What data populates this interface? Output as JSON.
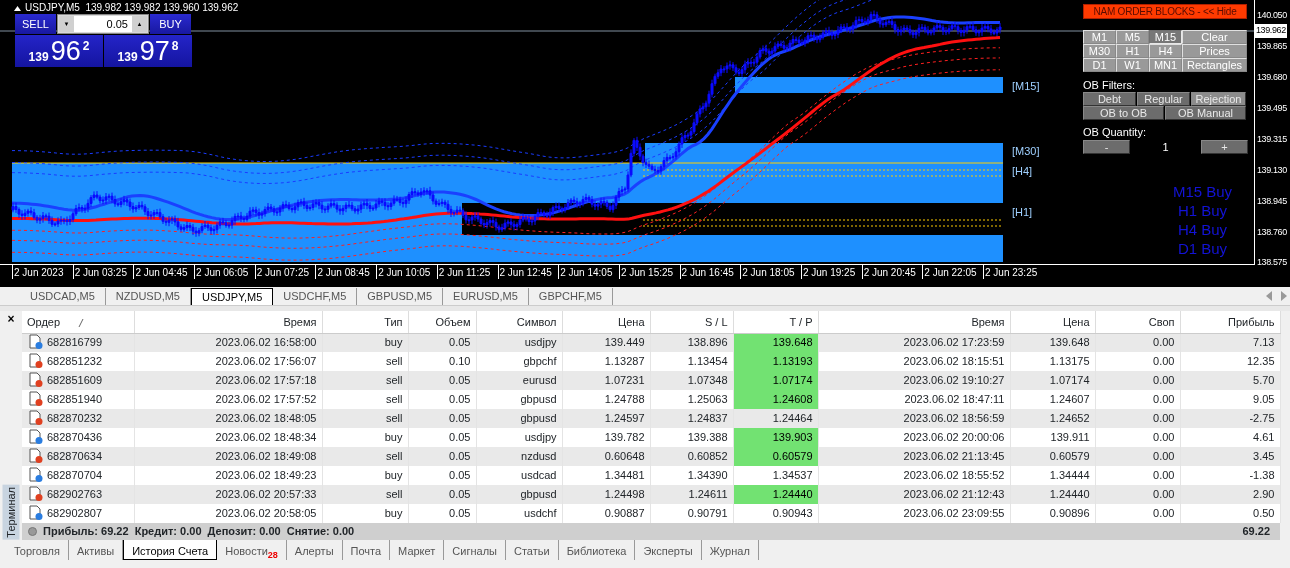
{
  "chart": {
    "title": "USDJPY,M5",
    "ohlc": "139.982 139.982 139.960 139.962"
  },
  "trade_panel": {
    "sell_label": "SELL",
    "buy_label": "BUY",
    "lot": "0.05",
    "down_arrow": "▼",
    "up_arrow": "▲",
    "sell_price": {
      "prefix": "139",
      "big": "96",
      "small": "2"
    },
    "buy_price": {
      "prefix": "139",
      "big": "97",
      "small": "8"
    }
  },
  "price_axis": {
    "current": "139.962",
    "labels": [
      "140.050",
      "139.865",
      "139.680",
      "139.495",
      "139.315",
      "139.130",
      "138.945",
      "138.760",
      "138.575"
    ]
  },
  "time_axis": [
    "2 Jun 2023",
    "2 Jun 03:25",
    "2 Jun 04:45",
    "2 Jun 06:05",
    "2 Jun 07:25",
    "2 Jun 08:45",
    "2 Jun 10:05",
    "2 Jun 11:25",
    "2 Jun 12:45",
    "2 Jun 14:05",
    "2 Jun 15:25",
    "2 Jun 16:45",
    "2 Jun 18:05",
    "2 Jun 19:25",
    "2 Jun 20:45",
    "2 Jun 22:05",
    "2 Jun 23:25"
  ],
  "zone_labels": [
    "[M15]",
    "[M30]",
    "[H4]",
    "[H1]"
  ],
  "indicator_panel": {
    "header": "NAM ORDER BLOCKS - << Hide",
    "timeframes": [
      {
        "label": "M1",
        "selected": false
      },
      {
        "label": "M5",
        "selected": false
      },
      {
        "label": "M15",
        "selected": true
      },
      {
        "label": "M30",
        "selected": false
      },
      {
        "label": "H1",
        "selected": false
      },
      {
        "label": "H4",
        "selected": false
      },
      {
        "label": "D1",
        "selected": false
      },
      {
        "label": "W1",
        "selected": false
      },
      {
        "label": "MN1",
        "selected": false
      }
    ],
    "actions": [
      "Clear",
      "Prices",
      "Rectangles"
    ],
    "filters_label": "OB Filters:",
    "filters": [
      {
        "label": "Debt",
        "selected": false
      },
      {
        "label": "Regular",
        "selected": false
      },
      {
        "label": "Rejection",
        "selected": true
      }
    ],
    "modes": [
      "OB to OB",
      "OB Manual"
    ],
    "quantity_label": "OB Quantity:",
    "minus": "-",
    "quantity": "1",
    "plus": "+"
  },
  "signals": [
    "M15 Buy",
    "H1 Buy",
    "H4 Buy",
    "D1 Buy"
  ],
  "chart_tabs": [
    {
      "label": "USDCAD,M5",
      "selected": false
    },
    {
      "label": "NZDUSD,M5",
      "selected": false
    },
    {
      "label": "USDJPY,M5",
      "selected": true
    },
    {
      "label": "USDCHF,M5",
      "selected": false
    },
    {
      "label": "GBPUSD,M5",
      "selected": false
    },
    {
      "label": "EURUSD,M5",
      "selected": false
    },
    {
      "label": "GBPCHF,M5",
      "selected": false
    }
  ],
  "terminal": {
    "close": "×",
    "label": "Терминал"
  },
  "table": {
    "columns": [
      "Ордер",
      "Время",
      "Тип",
      "Объем",
      "Символ",
      "Цена",
      "S / L",
      "T / P",
      "Время",
      "Цена",
      "Своп",
      "Прибыль"
    ],
    "rows": [
      {
        "kind": "buy",
        "order": "682816799",
        "open_time": "2023.06.02 16:58:00",
        "type": "buy",
        "volume": "0.05",
        "symbol": "usdjpy",
        "price": "139.449",
        "sl": "138.896",
        "tp": "139.648",
        "tp_hit": true,
        "close_time": "2023.06.02 17:23:59",
        "close_price": "139.648",
        "swap": "0.00",
        "profit": "7.13"
      },
      {
        "kind": "sell",
        "order": "682851232",
        "open_time": "2023.06.02 17:56:07",
        "type": "sell",
        "volume": "0.10",
        "symbol": "gbpchf",
        "price": "1.13287",
        "sl": "1.13454",
        "tp": "1.13193",
        "tp_hit": true,
        "close_time": "2023.06.02 18:15:51",
        "close_price": "1.13175",
        "swap": "0.00",
        "profit": "12.35"
      },
      {
        "kind": "sell",
        "order": "682851609",
        "open_time": "2023.06.02 17:57:18",
        "type": "sell",
        "volume": "0.05",
        "symbol": "eurusd",
        "price": "1.07231",
        "sl": "1.07348",
        "tp": "1.07174",
        "tp_hit": true,
        "close_time": "2023.06.02 19:10:27",
        "close_price": "1.07174",
        "swap": "0.00",
        "profit": "5.70"
      },
      {
        "kind": "sell",
        "order": "682851940",
        "open_time": "2023.06.02 17:57:52",
        "type": "sell",
        "volume": "0.05",
        "symbol": "gbpusd",
        "price": "1.24788",
        "sl": "1.25063",
        "tp": "1.24608",
        "tp_hit": true,
        "close_time": "2023.06.02 18:47:11",
        "close_price": "1.24607",
        "swap": "0.00",
        "profit": "9.05"
      },
      {
        "kind": "sell",
        "order": "682870232",
        "open_time": "2023.06.02 18:48:05",
        "type": "sell",
        "volume": "0.05",
        "symbol": "gbpusd",
        "price": "1.24597",
        "sl": "1.24837",
        "tp": "1.24464",
        "tp_hit": false,
        "close_time": "2023.06.02 18:56:59",
        "close_price": "1.24652",
        "swap": "0.00",
        "profit": "-2.75"
      },
      {
        "kind": "buy",
        "order": "682870436",
        "open_time": "2023.06.02 18:48:34",
        "type": "buy",
        "volume": "0.05",
        "symbol": "usdjpy",
        "price": "139.782",
        "sl": "139.388",
        "tp": "139.903",
        "tp_hit": true,
        "close_time": "2023.06.02 20:00:06",
        "close_price": "139.911",
        "swap": "0.00",
        "profit": "4.61"
      },
      {
        "kind": "sell",
        "order": "682870634",
        "open_time": "2023.06.02 18:49:08",
        "type": "sell",
        "volume": "0.05",
        "symbol": "nzdusd",
        "price": "0.60648",
        "sl": "0.60852",
        "tp": "0.60579",
        "tp_hit": true,
        "close_time": "2023.06.02 21:13:45",
        "close_price": "0.60579",
        "swap": "0.00",
        "profit": "3.45"
      },
      {
        "kind": "buy",
        "order": "682870704",
        "open_time": "2023.06.02 18:49:23",
        "type": "buy",
        "volume": "0.05",
        "symbol": "usdcad",
        "price": "1.34481",
        "sl": "1.34390",
        "tp": "1.34537",
        "tp_hit": false,
        "close_time": "2023.06.02 18:55:52",
        "close_price": "1.34444",
        "swap": "0.00",
        "profit": "-1.38"
      },
      {
        "kind": "sell",
        "order": "682902763",
        "open_time": "2023.06.02 20:57:33",
        "type": "sell",
        "volume": "0.05",
        "symbol": "gbpusd",
        "price": "1.24498",
        "sl": "1.24611",
        "tp": "1.24440",
        "tp_hit": true,
        "close_time": "2023.06.02 21:12:43",
        "close_price": "1.24440",
        "swap": "0.00",
        "profit": "2.90"
      },
      {
        "kind": "buy",
        "order": "682902807",
        "open_time": "2023.06.02 20:58:05",
        "type": "buy",
        "volume": "0.05",
        "symbol": "usdchf",
        "price": "0.90887",
        "sl": "0.90791",
        "tp": "0.90943",
        "tp_hit": false,
        "close_time": "2023.06.02 23:09:55",
        "close_price": "0.90896",
        "swap": "0.00",
        "profit": "0.50"
      }
    ],
    "summary": "Прибыль: 69.22  Кредит: 0.00  Депозит: 0.00  Снятие: 0.00",
    "total": "69.22"
  },
  "bottom_tabs": [
    {
      "label": "Торговля",
      "selected": false
    },
    {
      "label": "Активы",
      "selected": false
    },
    {
      "label": "История Счета",
      "selected": true
    },
    {
      "label": "Новости",
      "badge": "28",
      "selected": false
    },
    {
      "label": "Алерты",
      "selected": false
    },
    {
      "label": "Почта",
      "selected": false
    },
    {
      "label": "Маркет",
      "selected": false
    },
    {
      "label": "Сигналы",
      "selected": false
    },
    {
      "label": "Статьи",
      "selected": false
    },
    {
      "label": "Библиотека",
      "selected": false
    },
    {
      "label": "Эксперты",
      "selected": false
    },
    {
      "label": "Журнал",
      "selected": false
    }
  ]
}
